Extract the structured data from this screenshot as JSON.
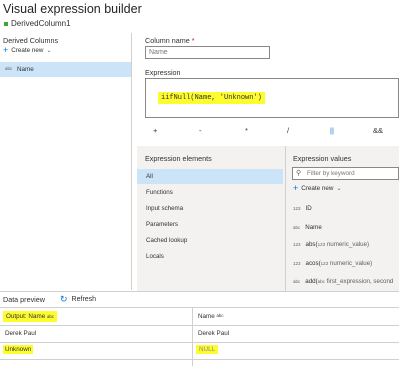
{
  "header": {
    "title": "Visual expression builder",
    "transform_name": "DerivedColumn1"
  },
  "left_panel": {
    "heading": "Derived Columns",
    "create_new": "Create new",
    "items": [
      {
        "type": "abc",
        "label": "Name"
      }
    ]
  },
  "column_name": {
    "label": "Column name",
    "required_mark": "*",
    "value": "",
    "placeholder": "Name"
  },
  "expression": {
    "label": "Expression",
    "text": "iifNull(Name, 'Unknown')"
  },
  "operators": [
    "+",
    "-",
    "*",
    "/",
    "||",
    "&&"
  ],
  "elements": {
    "heading": "Expression elements",
    "items": [
      "All",
      "Functions",
      "Input schema",
      "Parameters",
      "Cached lookup",
      "Locals"
    ]
  },
  "values": {
    "heading": "Expression values",
    "filter_placeholder": "Filter by keyword",
    "create_new": "Create new",
    "items": [
      {
        "icon": "123",
        "name": "ID",
        "args": ""
      },
      {
        "icon": "abc",
        "name": "Name",
        "args": ""
      },
      {
        "icon": "123",
        "name": "abs(",
        "args": "numeric_value)"
      },
      {
        "icon": "123",
        "name": "acos(",
        "args": "numeric_value)"
      },
      {
        "icon": "abc",
        "name": "add(",
        "args": "first_expression, second"
      }
    ],
    "args_icons": [
      "123",
      "123",
      "abc"
    ]
  },
  "preview": {
    "label": "Data preview",
    "refresh": "Refresh",
    "columns": [
      {
        "label": "Output: Name",
        "type": "abc"
      },
      {
        "label": "Name",
        "type": "abc"
      }
    ],
    "rows": [
      [
        "Derek Paul",
        "Derek Paul"
      ],
      [
        "Unknown",
        "NULL"
      ]
    ]
  },
  "colors": {
    "accent": "#0078d4",
    "selected": "#cce4f7",
    "highlight": "#fcfc2e",
    "status_green": "#3aa835"
  }
}
